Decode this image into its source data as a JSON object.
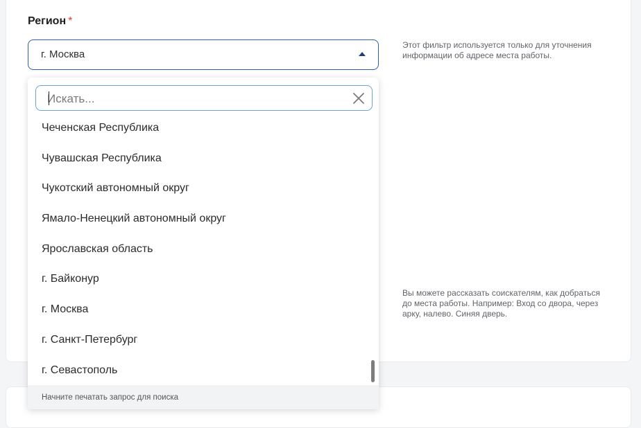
{
  "field": {
    "label": "Регион",
    "required_mark": "*",
    "selected_value": "г. Москва"
  },
  "hints": {
    "region_hint": "Этот фильтр используется только для уточнения информации об адресе места работы.",
    "directions_hint": "Вы можете рассказать соискателям, как добраться до места работы. Например: Вход со двора, через арку, налево. Синяя дверь."
  },
  "dropdown": {
    "search_placeholder": "Искать...",
    "items": [
      "Чеченская Республика",
      "Чувашская Республика",
      "Чукотский автономный округ",
      "Ямало-Ненецкий автономный округ",
      "Ярославская область",
      "г. Байконур",
      "г. Москва",
      "г. Санкт-Петербург",
      "г. Севастополь"
    ],
    "footer_text": "Начните печатать запрос для поиска"
  },
  "icons": {
    "caret": "caret-up-icon",
    "clear": "close-icon"
  },
  "colors": {
    "select_border": "#2b5fa8",
    "search_border": "#6aa3d8",
    "required": "#e53935"
  }
}
